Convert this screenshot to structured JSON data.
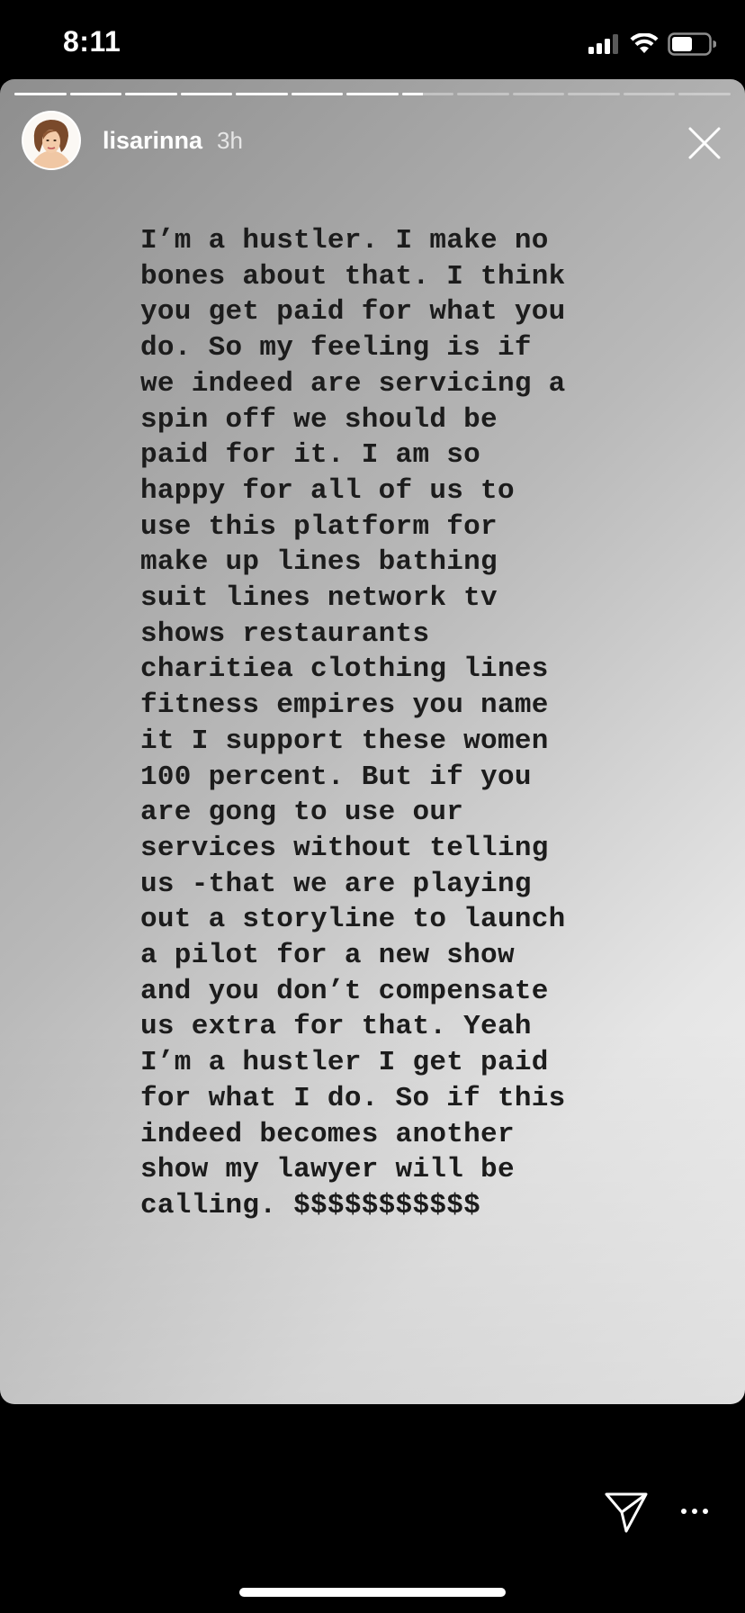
{
  "status_bar": {
    "time": "8:11",
    "icons": [
      "cellular-signal-icon",
      "wifi-icon",
      "battery-icon"
    ]
  },
  "story": {
    "progress_segments": 13,
    "current_segment": 7,
    "current_segment_progress": 0.4,
    "username": "lisarinna",
    "time_ago": "3h",
    "text_lines": [
      "I’m a hustler. I make no",
      "bones about that. I think",
      "you get paid for what you",
      "do. So my feeling is if",
      "we indeed are servicing a",
      "spin off we should be",
      "paid for it. I am so",
      "happy for all of us to",
      "use this platform for",
      "make up lines bathing",
      "suit lines network tv",
      "shows restaurants",
      "charitiea clothing lines",
      "fitness empires you name",
      "it I support these women",
      "100 percent. But if you",
      "are gong to use our",
      "services without telling",
      "us -that we are playing",
      "out a storyline to launch",
      "a pilot for a new show",
      "and you don’t compensate",
      "us extra for that. Yeah",
      "I’m a hustler I get paid",
      "for what I do. So if this",
      "indeed becomes another",
      "show my lawyer will be",
      "calling. $$$$$$$$$$$"
    ],
    "close_icon": "close-icon"
  },
  "bottom_bar": {
    "share_icon": "send-icon",
    "more_icon": "more-options-icon"
  }
}
